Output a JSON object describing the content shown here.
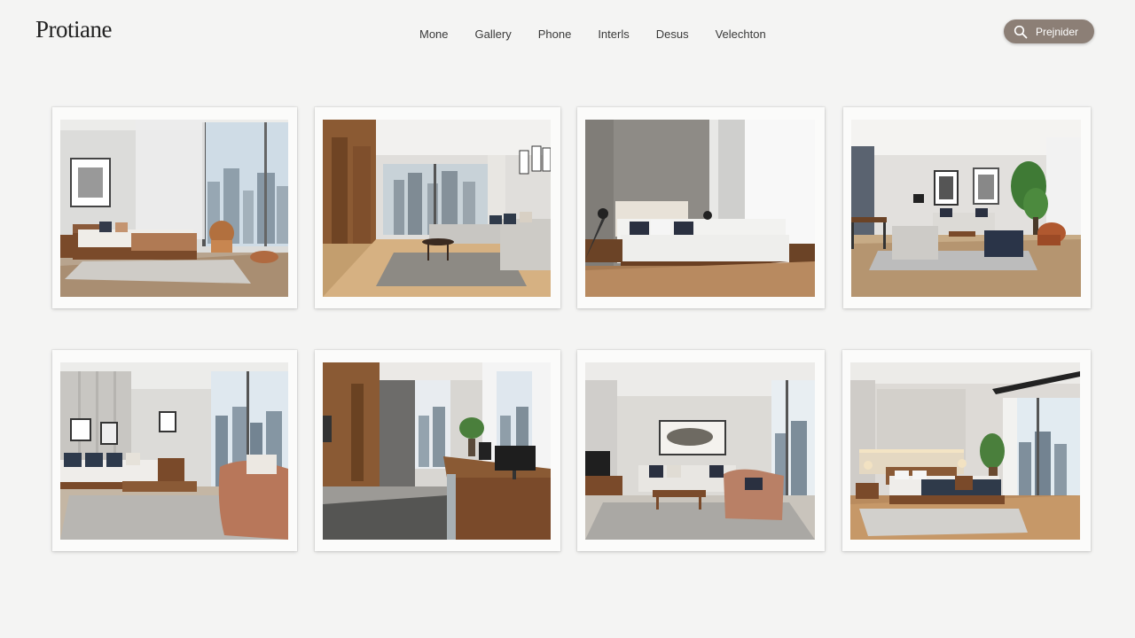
{
  "header": {
    "logo": "Protiane",
    "nav": [
      "Mone",
      "Gallery",
      "Phone",
      "Interls",
      "Desus",
      "Velechton"
    ],
    "search_label": "Prejnider"
  },
  "gallery": {
    "items": [
      {
        "scene": "bedroom-city-view"
      },
      {
        "scene": "living-room-sectional"
      },
      {
        "scene": "bedroom-curtains"
      },
      {
        "scene": "open-living-dining"
      },
      {
        "scene": "living-room-leather-chair"
      },
      {
        "scene": "office-desk-wood"
      },
      {
        "scene": "living-room-artwork"
      },
      {
        "scene": "bedroom-skyline"
      }
    ]
  },
  "colors": {
    "background": "#f4f4f3",
    "accent": "#8c7f76",
    "card": "#fbfbfa"
  }
}
